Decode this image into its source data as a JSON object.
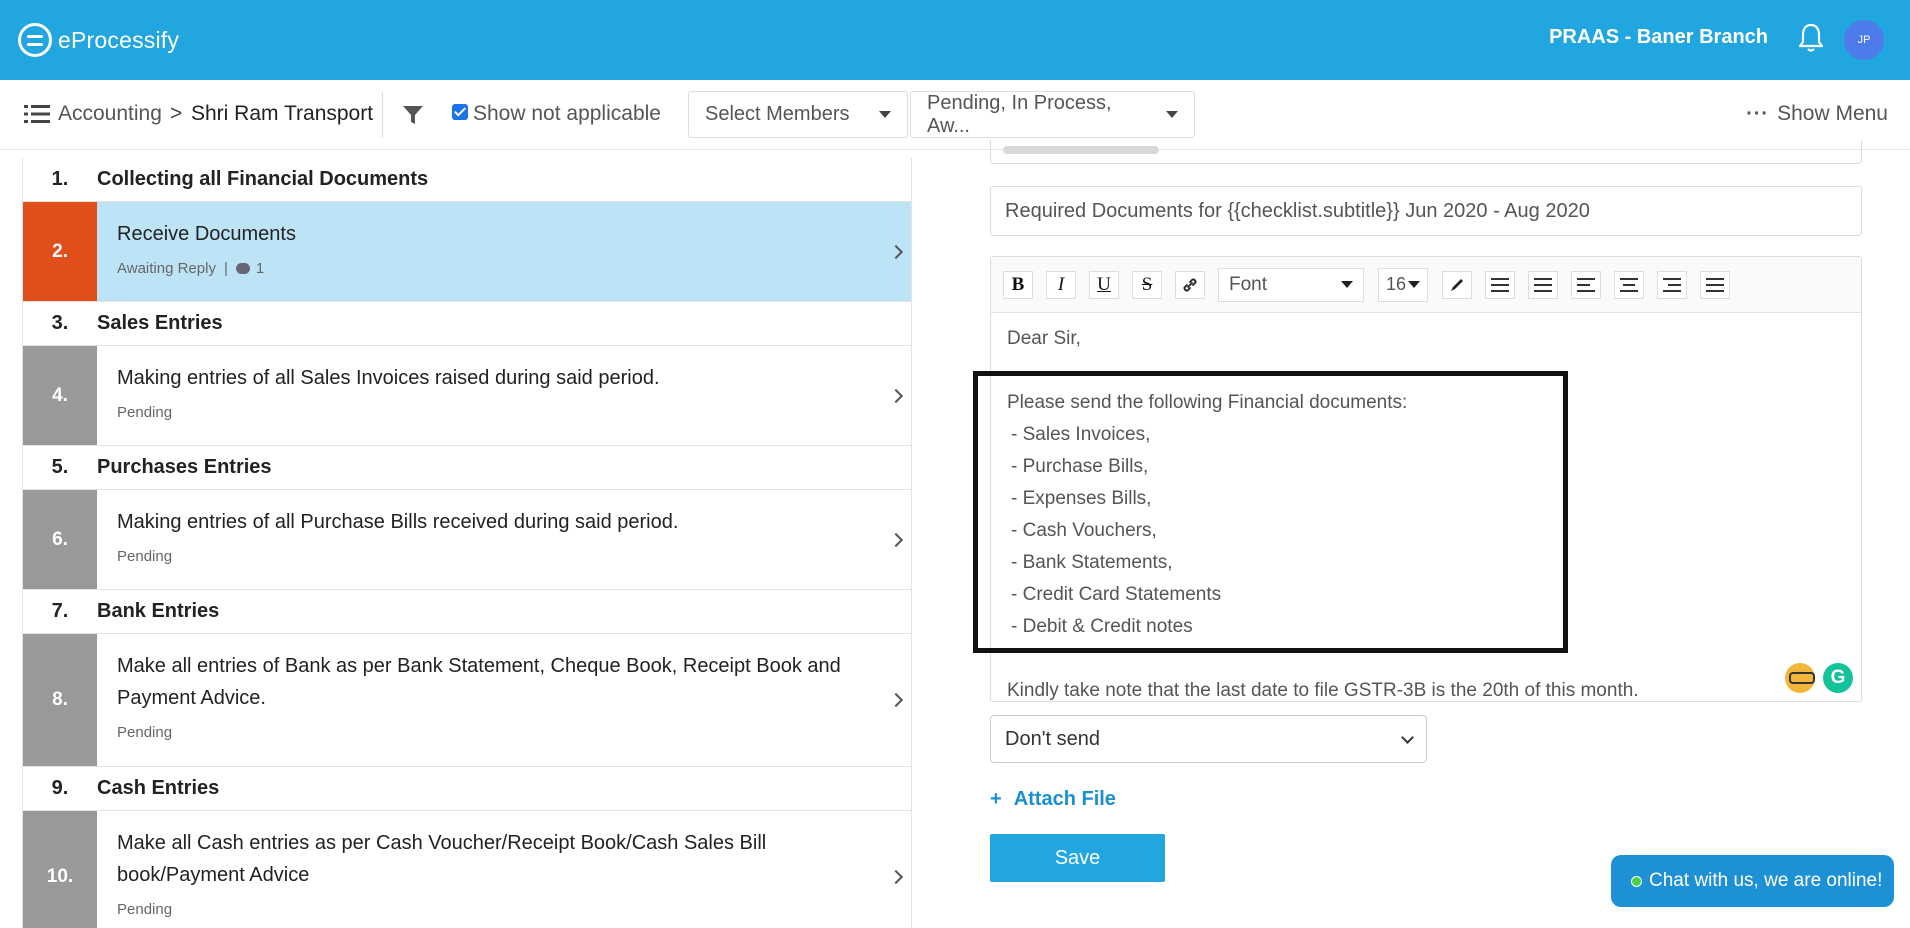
{
  "header": {
    "app_name": "eProcessify",
    "branch": "PRAAS - Baner Branch",
    "avatar_initials": "JP",
    "bar_color": "#21a6e0"
  },
  "toolbar": {
    "breadcrumb_root": "Accounting",
    "breadcrumb_sep": ">",
    "breadcrumb_current": "Shri Ram Transport",
    "show_not_applicable": "Show not applicable",
    "show_not_applicable_checked": true,
    "members_dropdown": "Select Members",
    "status_dropdown": "Pending, In Process, Aw...",
    "show_menu": "Show Menu"
  },
  "checklist": [
    {
      "num": "1.",
      "title": "Collecting all Financial Documents"
    },
    {
      "num": "2.",
      "title": "Receive Documents",
      "status": "Awaiting Reply",
      "comments": "1",
      "active": true,
      "color": "#e04f1b"
    },
    {
      "num": "3.",
      "title": "Sales Entries"
    },
    {
      "num": "4.",
      "title": "Making entries of all Sales Invoices raised during said period.",
      "status": "Pending"
    },
    {
      "num": "5.",
      "title": "Purchases Entries"
    },
    {
      "num": "6.",
      "title": "Making entries of all Purchase Bills received during said period.",
      "status": "Pending"
    },
    {
      "num": "7.",
      "title": "Bank Entries"
    },
    {
      "num": "8.",
      "title": "Make all entries of Bank as per Bank Statement, Cheque Book, Receipt Book and Payment Advice.",
      "status": "Pending"
    },
    {
      "num": "9.",
      "title": "Cash Entries"
    },
    {
      "num": "10.",
      "title": "Make all Cash entries as per Cash Voucher/Receipt Book/Cash Sales Bill book/Payment Advice",
      "status": "Pending"
    }
  ],
  "editor": {
    "subject": "Required Documents for {{checklist.subtitle}} Jun 2020 - Aug 2020",
    "toolbar": {
      "bold": "B",
      "italic": "I",
      "underline": "U",
      "strike": "S",
      "font": "Font",
      "size": "16"
    },
    "body": {
      "greeting": "Dear Sir,",
      "intro": "Please send the following Financial documents:",
      "items": [
        " - Sales Invoices,",
        " - Purchase Bills,",
        " - Expenses Bills,",
        " - Cash Vouchers,",
        " - Bank Statements,",
        " - Credit Card Statements",
        " - Debit & Credit notes"
      ],
      "note": "Kindly take note that the last date to file GSTR-3B is the 20th of this month."
    },
    "grammarly": "G"
  },
  "send_select": "Don't send",
  "attach_file": "Attach File",
  "attach_plus": "+",
  "save": "Save",
  "chat": "Chat with us, we are online!"
}
